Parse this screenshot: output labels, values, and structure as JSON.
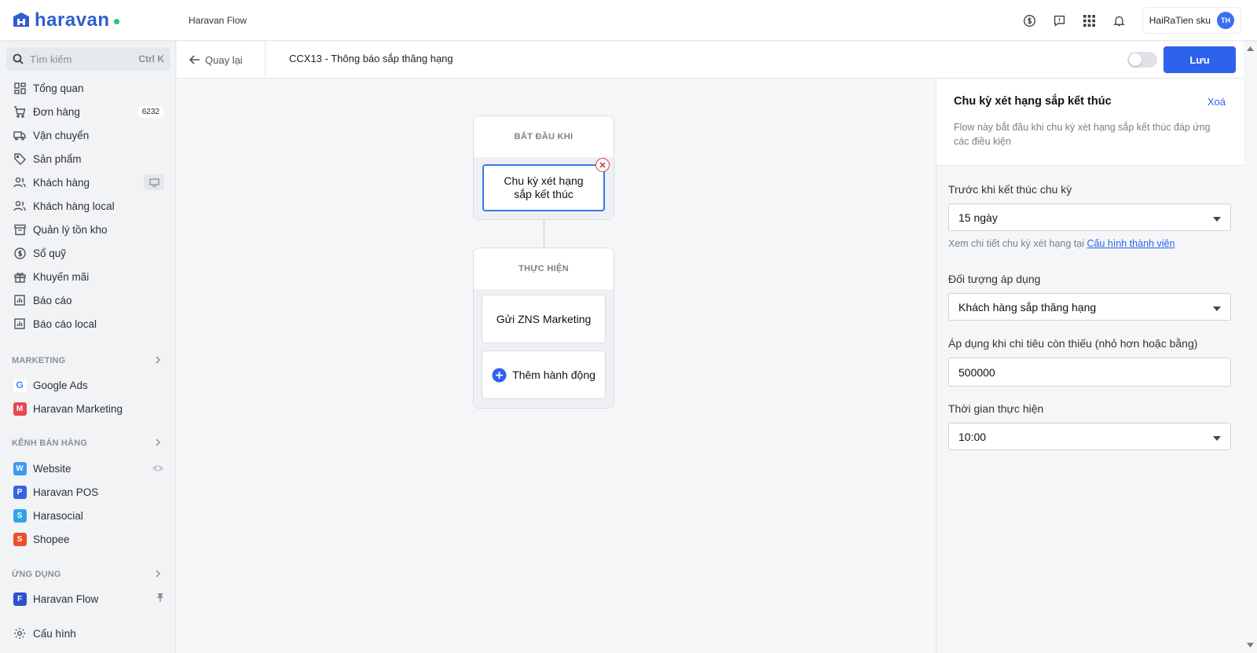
{
  "brand": {
    "logo_text": "haravan"
  },
  "header": {
    "app_name": "Haravan Flow",
    "user_name": "HaiRaTien sku",
    "user_initials": "TH"
  },
  "sidebar": {
    "search_placeholder": "Tìm kiếm",
    "search_shortcut": "Ctrl K",
    "items": [
      {
        "label": "Tổng quan"
      },
      {
        "label": "Đơn hàng",
        "badge": "6232"
      },
      {
        "label": "Vận chuyển"
      },
      {
        "label": "Sản phẩm"
      },
      {
        "label": "Khách hàng"
      },
      {
        "label": "Khách hàng local"
      },
      {
        "label": "Quản lý tồn kho"
      },
      {
        "label": "Sổ quỹ"
      },
      {
        "label": "Khuyến mãi"
      },
      {
        "label": "Báo cáo"
      },
      {
        "label": "Báo cáo local"
      }
    ],
    "marketing_title": "MARKETING",
    "marketing_items": [
      {
        "label": "Google Ads"
      },
      {
        "label": "Haravan Marketing"
      }
    ],
    "channels_title": "KÊNH BÁN HÀNG",
    "channel_items": [
      {
        "label": "Website"
      },
      {
        "label": "Haravan POS"
      },
      {
        "label": "Harasocial"
      },
      {
        "label": "Shopee"
      }
    ],
    "apps_title": "ỨNG DỤNG",
    "app_items": [
      {
        "label": "Haravan Flow"
      }
    ],
    "settings_label": "Cấu hình"
  },
  "subheader": {
    "back_label": "Quay lại",
    "flow_title": "CCX13 - Thông báo sắp thăng hạng",
    "save_label": "Lưu"
  },
  "canvas": {
    "start_title": "BẮT ĐẦU KHI",
    "trigger_node": "Chu kỳ xét hạng sắp kết thúc",
    "action_title": "THỰC HIỆN",
    "action_node": "Gửi ZNS Marketing",
    "add_action_label": "Thêm hành động"
  },
  "panel": {
    "title": "Chu kỳ xét hạng sắp kết thúc",
    "delete_label": "Xoá",
    "description": "Flow này bắt đầu khi chu kỳ xét hạng sắp kết thúc đáp ứng các điều kiện",
    "field_before_label": "Trước khi kết thúc chu kỳ",
    "field_before_value": "15 ngày",
    "hint_text": "Xem chi tiết chu kỳ xét hạng tại",
    "hint_link": "Cấu hình thành viên",
    "field_target_label": "Đối tượng áp dụng",
    "field_target_value": "Khách hàng sắp thăng hạng",
    "field_spend_label": "Áp dụng khi chi tiêu còn thiếu (nhỏ hơn hoặc bằng)",
    "field_spend_value": "500000",
    "field_time_label": "Thời gian thực hiện",
    "field_time_value": "10:00"
  },
  "colors": {
    "primary": "#2d62ed",
    "brand": "#2f5fcf",
    "danger": "#d64545"
  }
}
